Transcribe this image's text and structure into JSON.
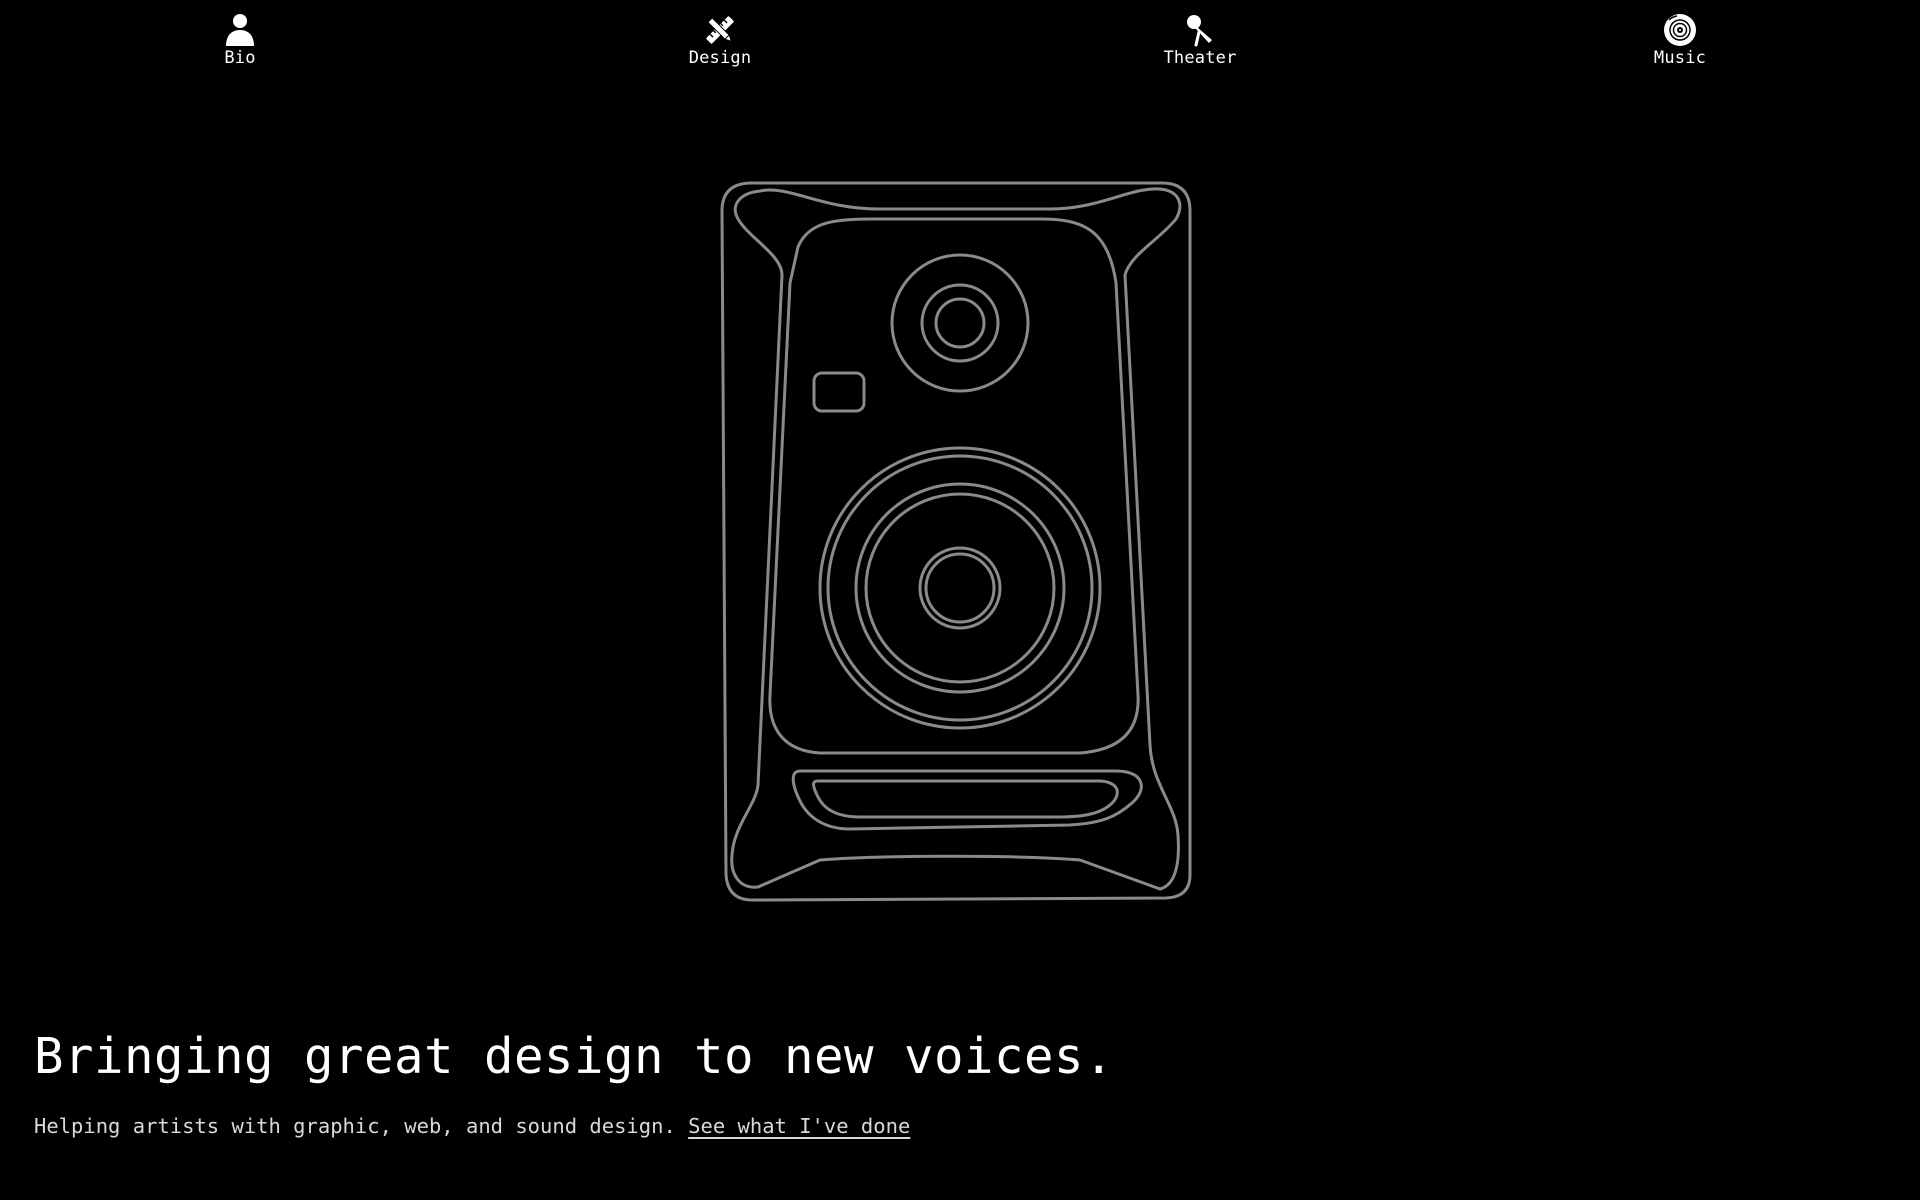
{
  "nav": {
    "items": [
      {
        "label": "Bio",
        "icon": "person-icon"
      },
      {
        "label": "Design",
        "icon": "pencil-ruler-icon"
      },
      {
        "label": "Theater",
        "icon": "microphone-icon"
      },
      {
        "label": "Music",
        "icon": "vinyl-record-icon"
      }
    ]
  },
  "hero": {
    "illustration": "studio-monitor-speaker-outline",
    "headline": "Bringing great design to new voices.",
    "subline": "Helping artists with graphic, web, and sound design.",
    "cta_link": "See what I've done"
  },
  "colors": {
    "background": "#000000",
    "text": "#ffffff",
    "subtext": "#d9d9d9",
    "illustration_stroke": "#8a8a8a"
  }
}
